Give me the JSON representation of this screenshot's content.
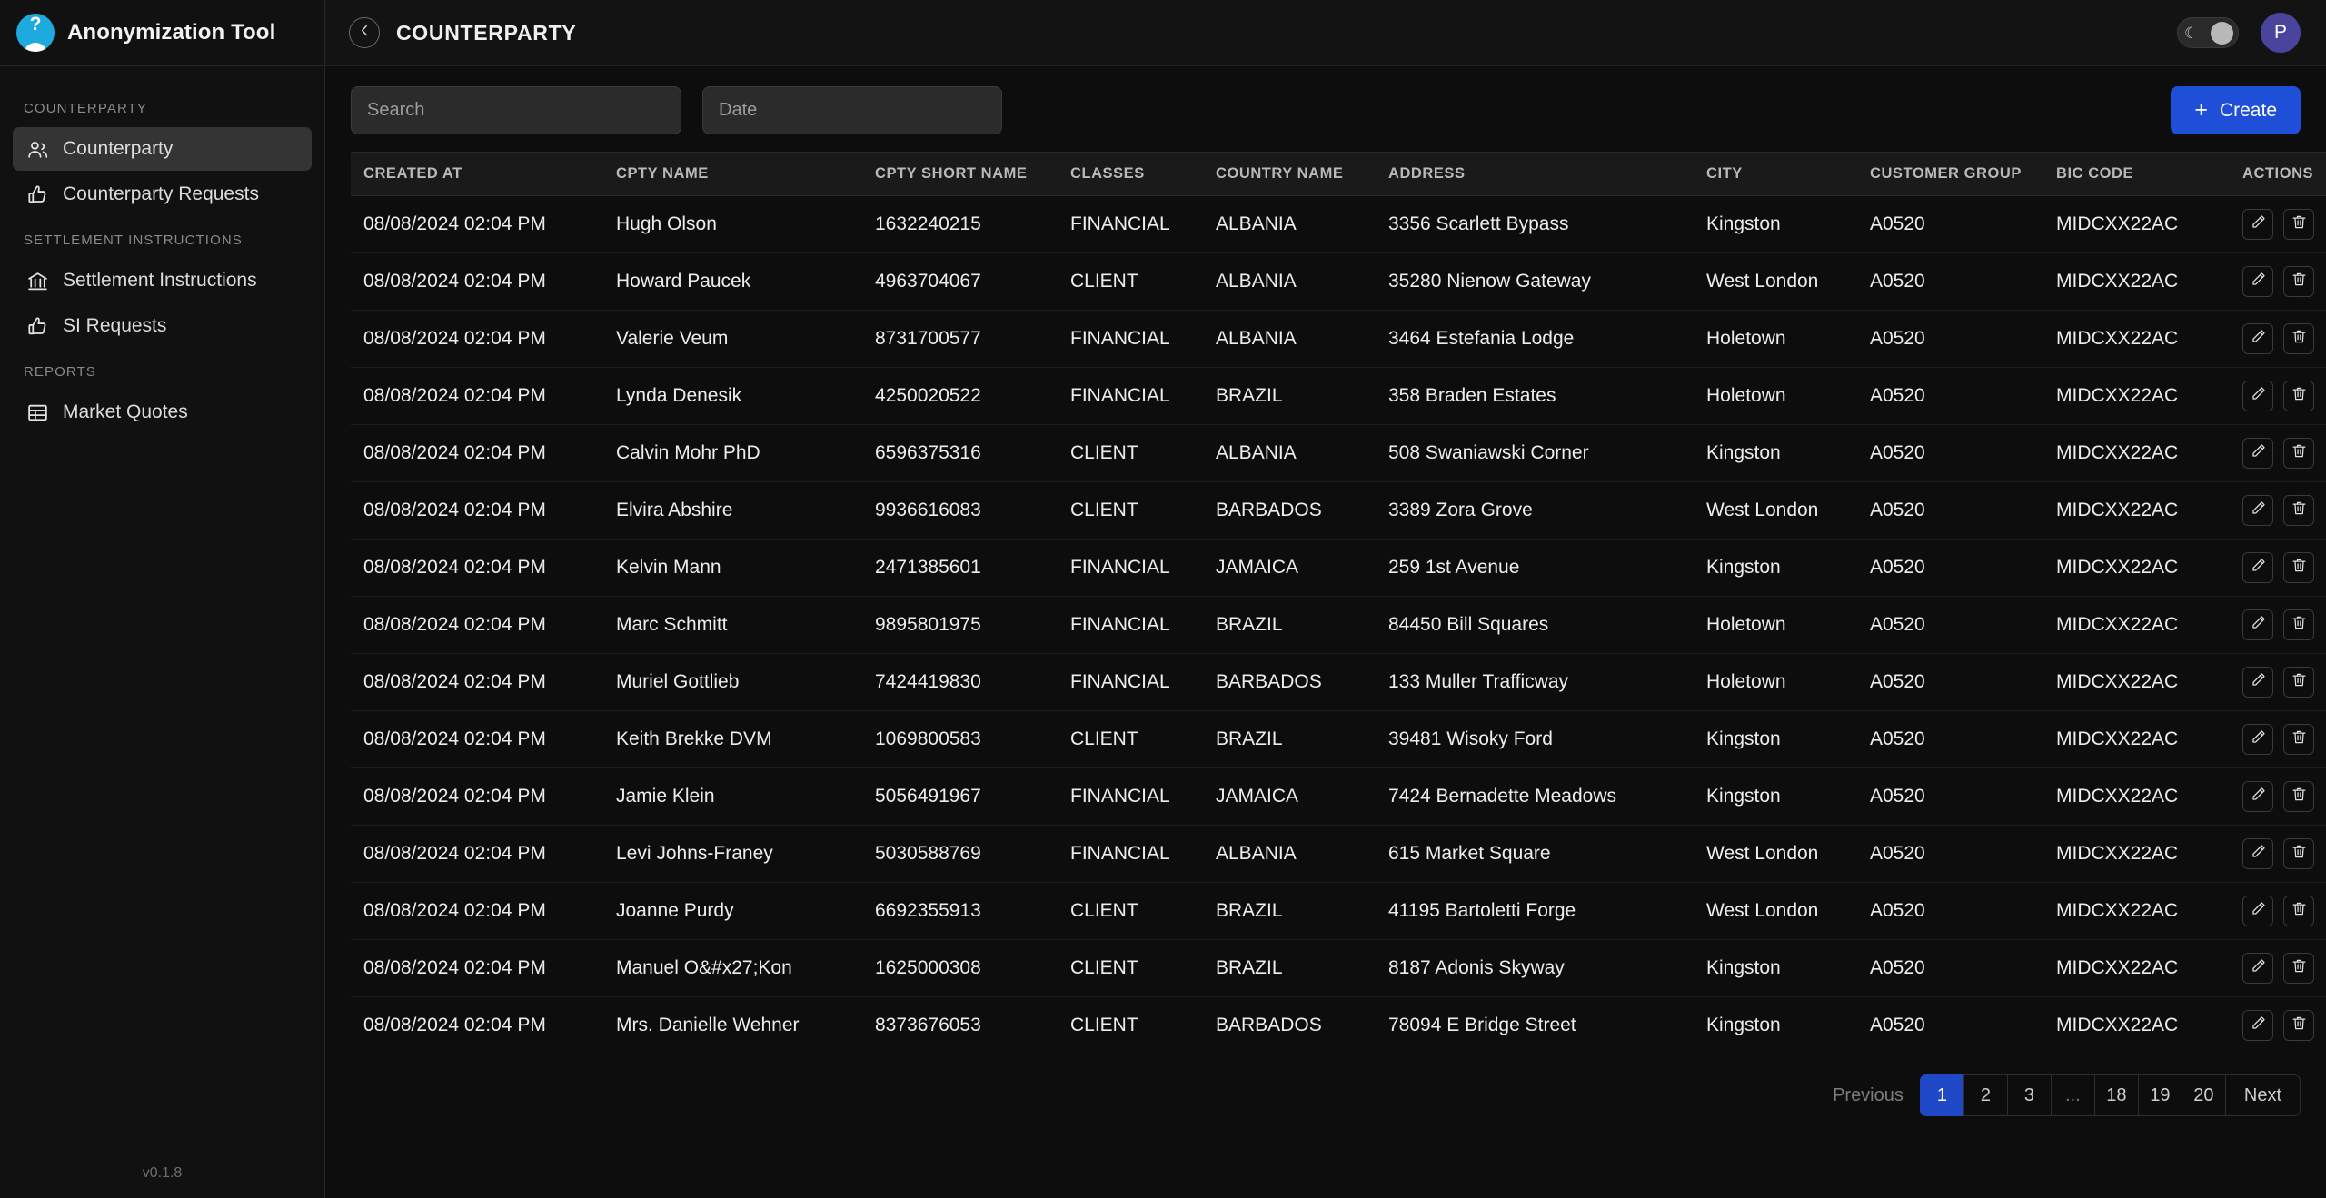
{
  "brand": {
    "title": "Anonymization Tool",
    "logo_icon": "question-avatar-icon",
    "version": "v0.1.8"
  },
  "sidebar": {
    "groups": [
      {
        "label": "COUNTERPARTY",
        "items": [
          {
            "label": "Counterparty",
            "icon": "users-icon",
            "active": true
          },
          {
            "label": "Counterparty Requests",
            "icon": "thumbs-up-icon",
            "active": false
          }
        ]
      },
      {
        "label": "SETTLEMENT INSTRUCTIONS",
        "items": [
          {
            "label": "Settlement Instructions",
            "icon": "bank-icon",
            "active": false
          },
          {
            "label": "SI Requests",
            "icon": "thumbs-up-icon",
            "active": false
          }
        ]
      },
      {
        "label": "REPORTS",
        "items": [
          {
            "label": "Market Quotes",
            "icon": "table-icon",
            "active": false
          }
        ]
      }
    ]
  },
  "topbar": {
    "back_icon": "chevron-left-icon",
    "title": "COUNTERPARTY",
    "theme_toggle": {
      "icon": "moon-icon",
      "state": "dark"
    },
    "avatar_initial": "P"
  },
  "toolbar": {
    "search_placeholder": "Search",
    "date_placeholder": "Date",
    "search_value": "",
    "date_value": "",
    "create_label": "Create",
    "create_icon": "plus-icon",
    "create_color": "#1f4fd8"
  },
  "table": {
    "columns": [
      "CREATED AT",
      "CPTY NAME",
      "CPTY SHORT NAME",
      "CLASSES",
      "COUNTRY NAME",
      "ADDRESS",
      "CITY",
      "CUSTOMER GROUP",
      "BIC CODE",
      "ACTIONS"
    ],
    "row_actions": [
      {
        "name": "edit-row-button",
        "icon": "pencil-icon"
      },
      {
        "name": "delete-row-button",
        "icon": "trash-icon"
      }
    ],
    "rows": [
      [
        "08/08/2024 02:04 PM",
        "Hugh Olson",
        "1632240215",
        "FINANCIAL",
        "ALBANIA",
        "3356 Scarlett Bypass",
        "Kingston",
        "A0520",
        "MIDCXX22AC"
      ],
      [
        "08/08/2024 02:04 PM",
        "Howard Paucek",
        "4963704067",
        "CLIENT",
        "ALBANIA",
        "35280 Nienow Gateway",
        "West London",
        "A0520",
        "MIDCXX22AC"
      ],
      [
        "08/08/2024 02:04 PM",
        "Valerie Veum",
        "8731700577",
        "FINANCIAL",
        "ALBANIA",
        "3464 Estefania Lodge",
        "Holetown",
        "A0520",
        "MIDCXX22AC"
      ],
      [
        "08/08/2024 02:04 PM",
        "Lynda Denesik",
        "4250020522",
        "FINANCIAL",
        "BRAZIL",
        "358 Braden Estates",
        "Holetown",
        "A0520",
        "MIDCXX22AC"
      ],
      [
        "08/08/2024 02:04 PM",
        "Calvin Mohr PhD",
        "6596375316",
        "CLIENT",
        "ALBANIA",
        "508 Swaniawski Corner",
        "Kingston",
        "A0520",
        "MIDCXX22AC"
      ],
      [
        "08/08/2024 02:04 PM",
        "Elvira Abshire",
        "9936616083",
        "CLIENT",
        "BARBADOS",
        "3389 Zora Grove",
        "West London",
        "A0520",
        "MIDCXX22AC"
      ],
      [
        "08/08/2024 02:04 PM",
        "Kelvin Mann",
        "2471385601",
        "FINANCIAL",
        "JAMAICA",
        "259 1st Avenue",
        "Kingston",
        "A0520",
        "MIDCXX22AC"
      ],
      [
        "08/08/2024 02:04 PM",
        "Marc Schmitt",
        "9895801975",
        "FINANCIAL",
        "BRAZIL",
        "84450 Bill Squares",
        "Holetown",
        "A0520",
        "MIDCXX22AC"
      ],
      [
        "08/08/2024 02:04 PM",
        "Muriel Gottlieb",
        "7424419830",
        "FINANCIAL",
        "BARBADOS",
        "133 Muller Trafficway",
        "Holetown",
        "A0520",
        "MIDCXX22AC"
      ],
      [
        "08/08/2024 02:04 PM",
        "Keith Brekke DVM",
        "1069800583",
        "CLIENT",
        "BRAZIL",
        "39481 Wisoky Ford",
        "Kingston",
        "A0520",
        "MIDCXX22AC"
      ],
      [
        "08/08/2024 02:04 PM",
        "Jamie Klein",
        "5056491967",
        "FINANCIAL",
        "JAMAICA",
        "7424 Bernadette Meadows",
        "Kingston",
        "A0520",
        "MIDCXX22AC"
      ],
      [
        "08/08/2024 02:04 PM",
        "Levi Johns-Franey",
        "5030588769",
        "FINANCIAL",
        "ALBANIA",
        "615 Market Square",
        "West London",
        "A0520",
        "MIDCXX22AC"
      ],
      [
        "08/08/2024 02:04 PM",
        "Joanne Purdy",
        "6692355913",
        "CLIENT",
        "BRAZIL",
        "41195 Bartoletti Forge",
        "West London",
        "A0520",
        "MIDCXX22AC"
      ],
      [
        "08/08/2024 02:04 PM",
        "Manuel O&#x27;Kon",
        "1625000308",
        "CLIENT",
        "BRAZIL",
        "8187 Adonis Skyway",
        "Kingston",
        "A0520",
        "MIDCXX22AC"
      ],
      [
        "08/08/2024 02:04 PM",
        "Mrs. Danielle Wehner",
        "8373676053",
        "CLIENT",
        "BARBADOS",
        "78094 E Bridge Street",
        "Kingston",
        "A0520",
        "MIDCXX22AC"
      ]
    ]
  },
  "pagination": {
    "previous_label": "Previous",
    "next_label": "Next",
    "pages": [
      "1",
      "2",
      "3",
      "...",
      "18",
      "19",
      "20"
    ],
    "current_page": "1",
    "active_color": "#2049c8"
  }
}
